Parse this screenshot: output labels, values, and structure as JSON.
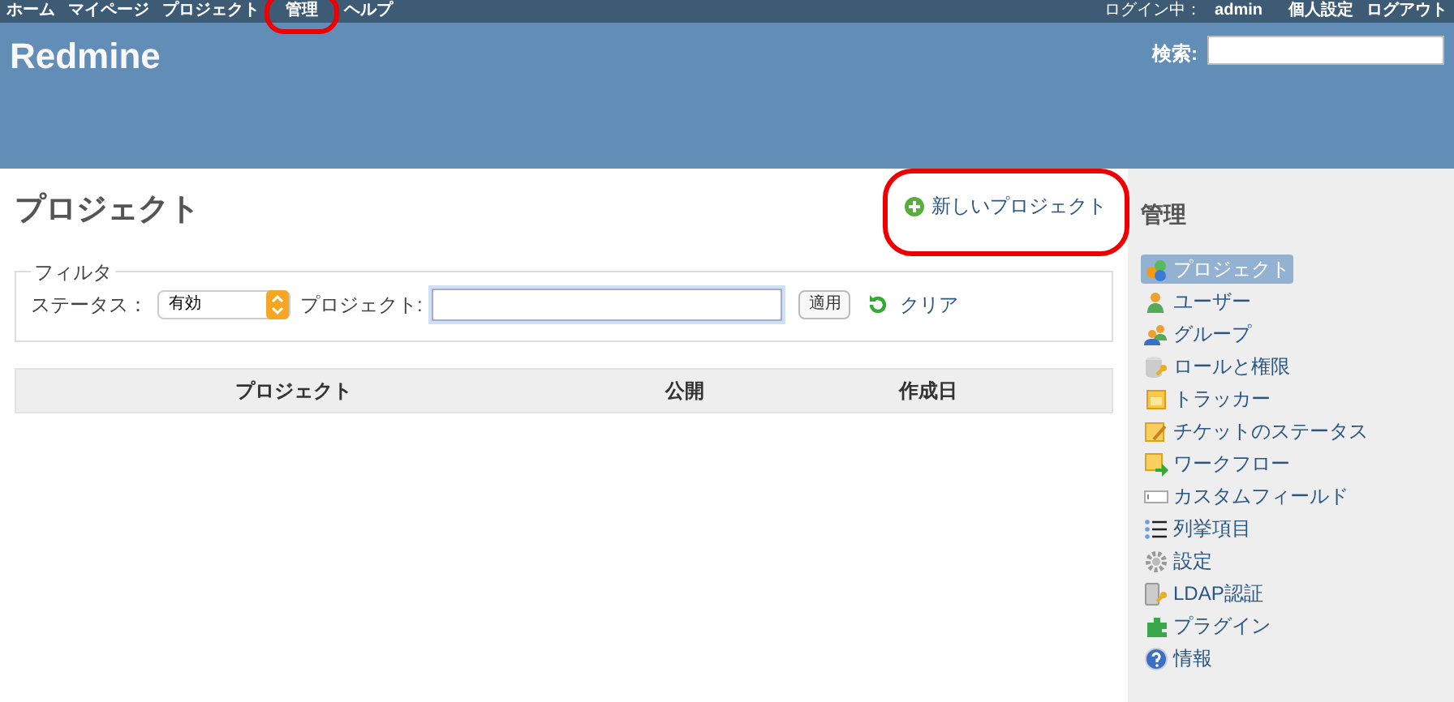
{
  "top_menu": [
    {
      "label": "ホーム",
      "highlighted": false
    },
    {
      "label": "マイページ",
      "highlighted": false
    },
    {
      "label": "プロジェクト",
      "highlighted": false
    },
    {
      "label": "管理",
      "highlighted": true
    },
    {
      "label": "ヘルプ",
      "highlighted": false
    }
  ],
  "account": {
    "login_label": "ログイン中：",
    "user": "admin",
    "links": [
      "個人設定",
      "ログアウト"
    ]
  },
  "header": {
    "title": "Redmine",
    "search_label": "検索:"
  },
  "page": {
    "title": "プロジェクト",
    "new_project": {
      "label": "新しいプロジェクト",
      "highlighted": true
    }
  },
  "filter": {
    "legend": "フィルタ",
    "status_label": "ステータス：",
    "status_value": "有効",
    "project_label": "プロジェクト:",
    "apply": "適用",
    "clear": "クリア"
  },
  "table": {
    "columns": [
      "プロジェクト",
      "公開",
      "作成日"
    ]
  },
  "sidebar": {
    "title": "管理",
    "items": [
      {
        "label": "プロジェクト",
        "selected": true
      },
      {
        "label": "ユーザー",
        "selected": false
      },
      {
        "label": "グループ",
        "selected": false
      },
      {
        "label": "ロールと権限",
        "selected": false
      },
      {
        "label": "トラッカー",
        "selected": false
      },
      {
        "label": "チケットのステータス",
        "selected": false
      },
      {
        "label": "ワークフロー",
        "selected": false
      },
      {
        "label": "カスタムフィールド",
        "selected": false
      },
      {
        "label": "列挙項目",
        "selected": false
      },
      {
        "label": "設定",
        "selected": false
      },
      {
        "label": "LDAP認証",
        "selected": false
      },
      {
        "label": "プラグイン",
        "selected": false
      },
      {
        "label": "情報",
        "selected": false
      }
    ]
  }
}
